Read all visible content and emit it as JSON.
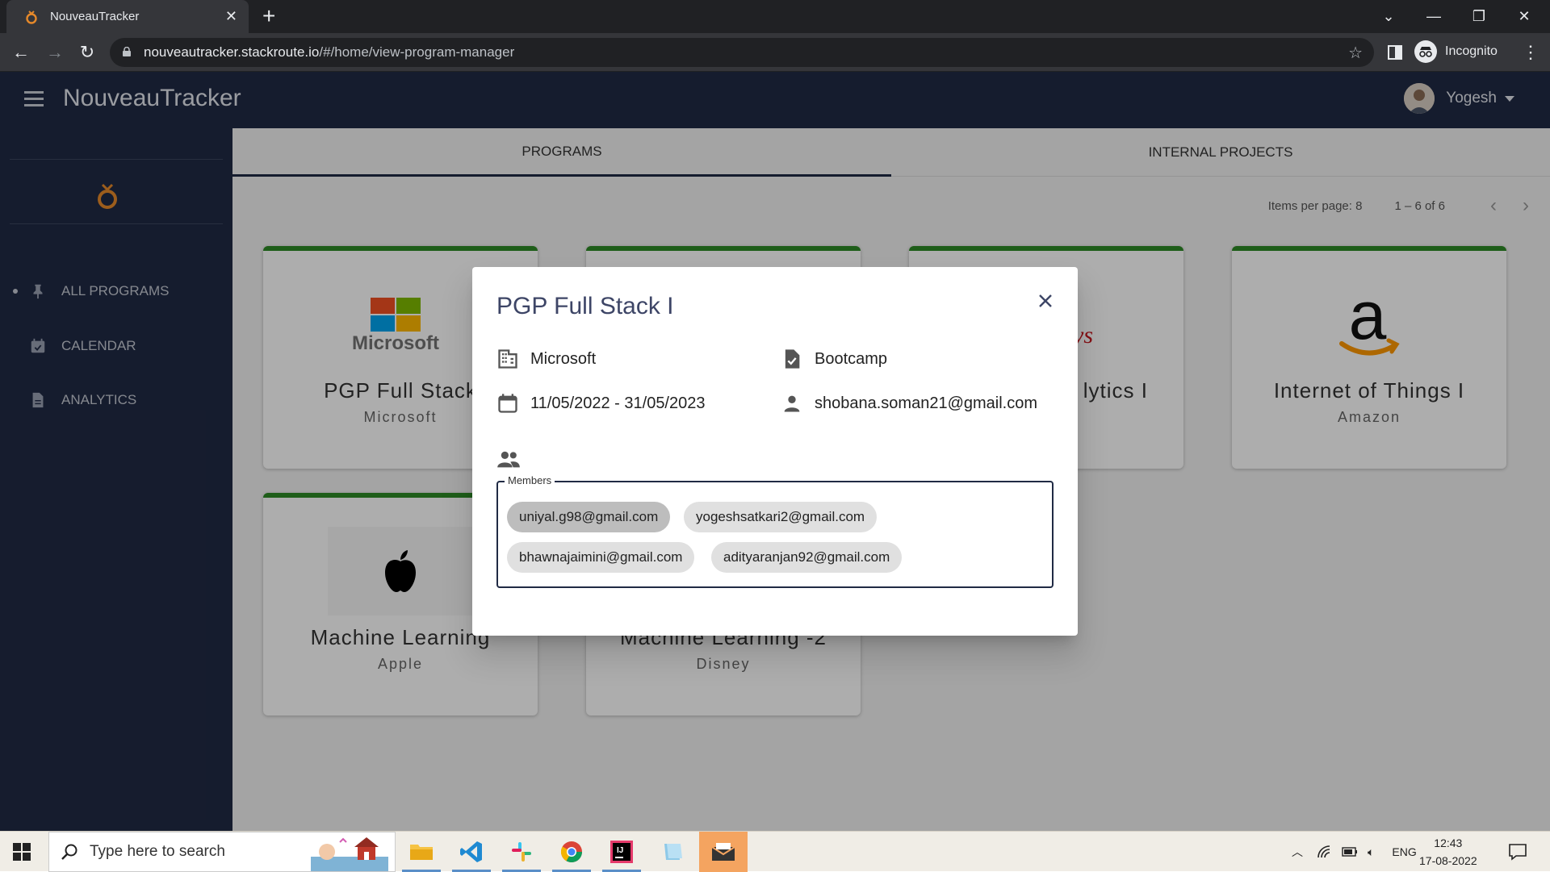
{
  "browser": {
    "tab_title": "NouveauTracker",
    "url_host": "nouveautracker.stackroute.io",
    "url_path": "/#/home/view-program-manager",
    "profile_label": "Incognito"
  },
  "app": {
    "title": "NouveauTracker",
    "user_name": "Yogesh",
    "colors": {
      "header": "#202a44",
      "card_accent": "#2d8a25"
    }
  },
  "sidebar": {
    "items": [
      {
        "label": "ALL PROGRAMS",
        "icon": "pin-icon"
      },
      {
        "label": "CALENDAR",
        "icon": "calendar-check-icon"
      },
      {
        "label": "ANALYTICS",
        "icon": "document-icon"
      }
    ]
  },
  "main": {
    "tabs": [
      {
        "label": "PROGRAMS",
        "active": true
      },
      {
        "label": "INTERNAL PROJECTS",
        "active": false
      }
    ],
    "pager": {
      "items_per_page_label": "Items per page: 8",
      "range_label": "1 – 6 of 6"
    },
    "cards": [
      {
        "title": "PGP Full Stack",
        "company": "Microsoft",
        "logo": "microsoft-logo"
      },
      {
        "title": "",
        "company": "",
        "logo": ""
      },
      {
        "title": "lytics I",
        "company": "",
        "logo": ""
      },
      {
        "title": "Internet of Things I",
        "company": "Amazon",
        "logo": "amazon-logo"
      },
      {
        "title": "Machine Learning",
        "company": "Apple",
        "logo": "apple-logo"
      },
      {
        "title": "Machine Learning -2",
        "company": "Disney",
        "logo": ""
      }
    ]
  },
  "dialog": {
    "title": "PGP Full Stack I",
    "company": "Microsoft",
    "type": "Bootcamp",
    "dates": "11/05/2022 - 31/05/2023",
    "manager_email": "shobana.soman21@gmail.com",
    "members_label": "Members",
    "members": [
      "uniyal.g98@gmail.com",
      "yogeshsatkari2@gmail.com",
      "bhawnajaimini@gmail.com",
      "adityaranjan92@gmail.com"
    ]
  },
  "taskbar": {
    "search_placeholder": "Type here to search",
    "language": "ENG",
    "time": "12:43",
    "date": "17-08-2022"
  }
}
